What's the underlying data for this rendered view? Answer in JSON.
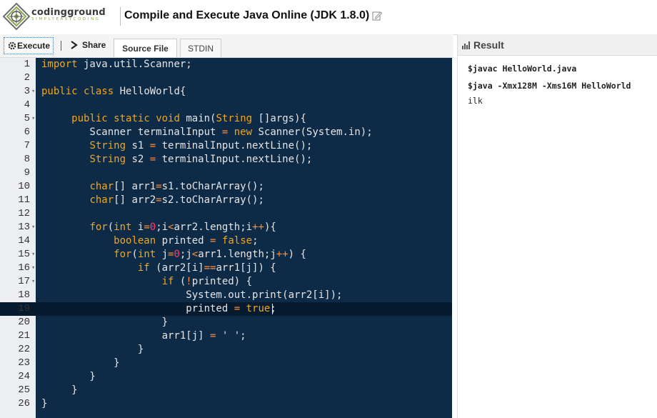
{
  "header": {
    "brand_name": "codingground",
    "brand_tagline": "SIMPLYEASYCODING",
    "title": "Compile and Execute Java Online (JDK 1.8.0)",
    "edit_icon": "edit-icon"
  },
  "toolbar": {
    "execute_label": "Execute",
    "share_label": "Share",
    "tabs": [
      {
        "label": "Source File",
        "active": true
      },
      {
        "label": "STDIN",
        "active": false
      }
    ]
  },
  "editor": {
    "active_line": 19,
    "lines": [
      {
        "n": "1",
        "fold": false,
        "code": "import java.util.Scanner;"
      },
      {
        "n": "2",
        "fold": false,
        "code": ""
      },
      {
        "n": "3",
        "fold": true,
        "code": "public class HelloWorld{"
      },
      {
        "n": "4",
        "fold": false,
        "code": ""
      },
      {
        "n": "5",
        "fold": true,
        "code": "     public static void main(String []args){"
      },
      {
        "n": "6",
        "fold": false,
        "code": "        Scanner terminalInput = new Scanner(System.in);"
      },
      {
        "n": "7",
        "fold": false,
        "code": "        String s1 = terminalInput.nextLine();"
      },
      {
        "n": "8",
        "fold": false,
        "code": "        String s2 = terminalInput.nextLine();"
      },
      {
        "n": "9",
        "fold": false,
        "code": ""
      },
      {
        "n": "10",
        "fold": false,
        "code": "        char[] arr1=s1.toCharArray();"
      },
      {
        "n": "11",
        "fold": false,
        "code": "        char[] arr2=s2.toCharArray();"
      },
      {
        "n": "12",
        "fold": false,
        "code": ""
      },
      {
        "n": "13",
        "fold": true,
        "code": "        for(int i=0;i<arr2.length;i++){"
      },
      {
        "n": "14",
        "fold": false,
        "code": "            boolean printed = false;"
      },
      {
        "n": "15",
        "fold": true,
        "code": "            for(int j=0;j<arr1.length;j++) {"
      },
      {
        "n": "16",
        "fold": true,
        "code": "                if (arr2[i]==arr1[j]) {"
      },
      {
        "n": "17",
        "fold": true,
        "code": "                    if (!printed) {"
      },
      {
        "n": "18",
        "fold": false,
        "code": "                        System.out.print(arr2[i]);"
      },
      {
        "n": "19",
        "fold": false,
        "code": "                        printed = true;"
      },
      {
        "n": "20",
        "fold": false,
        "code": "                    }"
      },
      {
        "n": "21",
        "fold": false,
        "code": "                    arr1[j] = ' ';"
      },
      {
        "n": "22",
        "fold": false,
        "code": "                }"
      },
      {
        "n": "23",
        "fold": false,
        "code": "            }"
      },
      {
        "n": "24",
        "fold": false,
        "code": "        }"
      },
      {
        "n": "25",
        "fold": false,
        "code": "     }"
      },
      {
        "n": "26",
        "fold": false,
        "code": "}"
      }
    ]
  },
  "result": {
    "title": "Result",
    "lines": [
      {
        "text": "$javac HelloWorld.java",
        "bold": true
      },
      {
        "text": "$java -Xmx128M -Xms16M HelloWorld",
        "bold": true
      },
      {
        "text": "ilk",
        "bold": false
      }
    ]
  },
  "colors": {
    "editor_bg": "#0d2a47",
    "keyword": "#f1a71e",
    "number": "#ff3c6e",
    "brand_green": "#8aa84a"
  }
}
